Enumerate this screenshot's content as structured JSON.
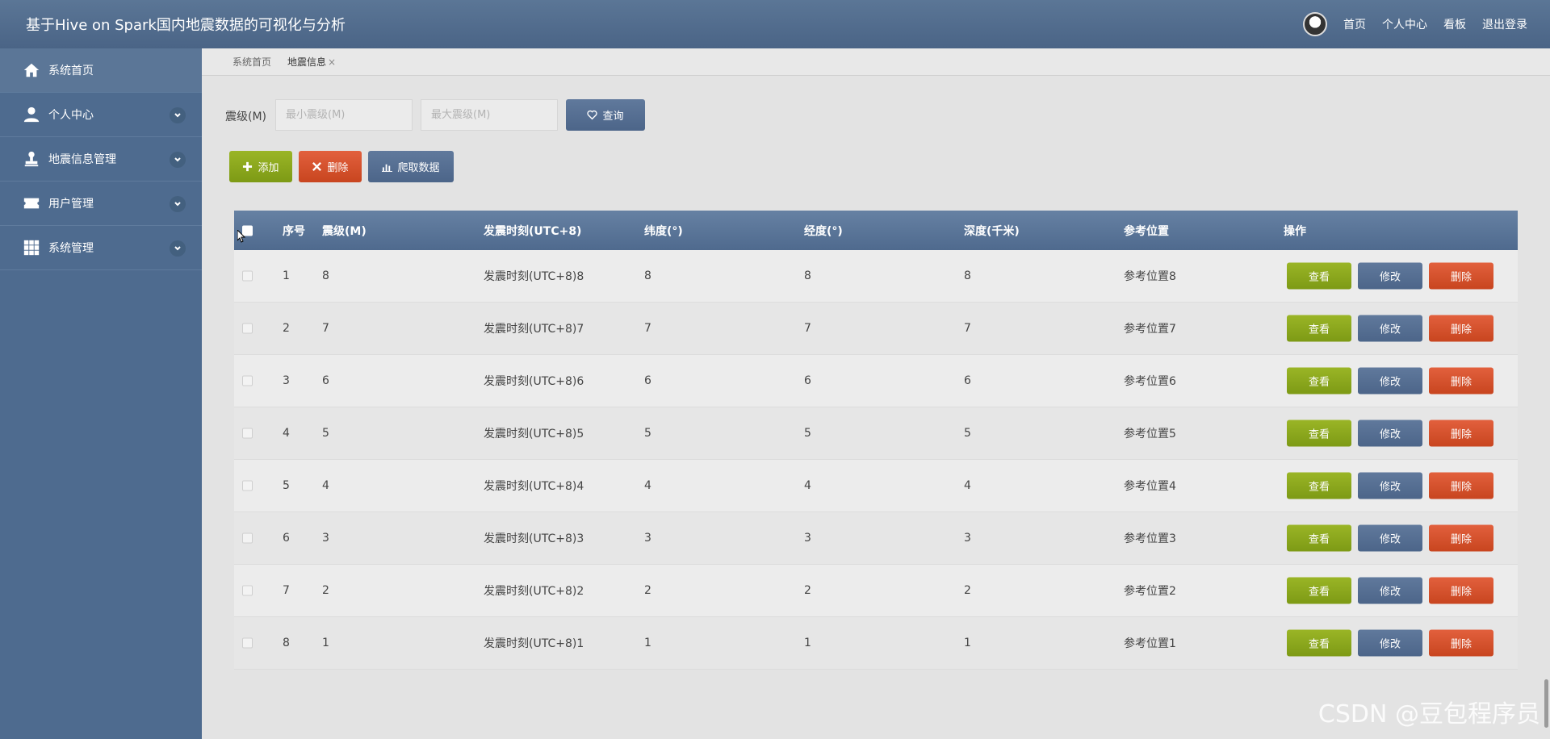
{
  "app": {
    "title": "基于Hive on Spark国内地震数据的可视化与分析"
  },
  "top_nav": [
    "首页",
    "个人中心",
    "看板",
    "退出登录"
  ],
  "sidebar": {
    "items": [
      {
        "label": "系统首页",
        "icon": "home-icon"
      },
      {
        "label": "个人中心",
        "icon": "user-icon"
      },
      {
        "label": "地震信息管理",
        "icon": "stamp-icon"
      },
      {
        "label": "用户管理",
        "icon": "ticket-icon"
      },
      {
        "label": "系统管理",
        "icon": "grid-icon"
      }
    ]
  },
  "breadcrumb": {
    "home": "系统首页",
    "current": "地震信息",
    "close": "×"
  },
  "search": {
    "label": "震级(M)",
    "min_placeholder": "最小震级(M)",
    "max_placeholder": "最大震级(M)",
    "query_label": "查询"
  },
  "actions": {
    "add": "添加",
    "delete": "删除",
    "crawl": "爬取数据"
  },
  "table": {
    "headers": [
      "序号",
      "震级(M)",
      "发震时刻(UTC+8)",
      "纬度(°)",
      "经度(°)",
      "深度(千米)",
      "参考位置",
      "操作"
    ],
    "rows": [
      [
        "1",
        "8",
        "发震时刻(UTC+8)8",
        "8",
        "8",
        "8",
        "参考位置8"
      ],
      [
        "2",
        "7",
        "发震时刻(UTC+8)7",
        "7",
        "7",
        "7",
        "参考位置7"
      ],
      [
        "3",
        "6",
        "发震时刻(UTC+8)6",
        "6",
        "6",
        "6",
        "参考位置6"
      ],
      [
        "4",
        "5",
        "发震时刻(UTC+8)5",
        "5",
        "5",
        "5",
        "参考位置5"
      ],
      [
        "5",
        "4",
        "发震时刻(UTC+8)4",
        "4",
        "4",
        "4",
        "参考位置4"
      ],
      [
        "6",
        "3",
        "发震时刻(UTC+8)3",
        "3",
        "3",
        "3",
        "参考位置3"
      ],
      [
        "7",
        "2",
        "发震时刻(UTC+8)2",
        "2",
        "2",
        "2",
        "参考位置2"
      ],
      [
        "8",
        "1",
        "发震时刻(UTC+8)1",
        "1",
        "1",
        "1",
        "参考位置1"
      ]
    ],
    "row_actions": {
      "view": "查看",
      "edit": "修改",
      "delete": "删除"
    }
  },
  "watermark": "CSDN @豆包程序员",
  "colors": {
    "header": "#4e6b8f",
    "green": "#8aa61c",
    "red": "#d4532c",
    "blue": "#566f93"
  }
}
